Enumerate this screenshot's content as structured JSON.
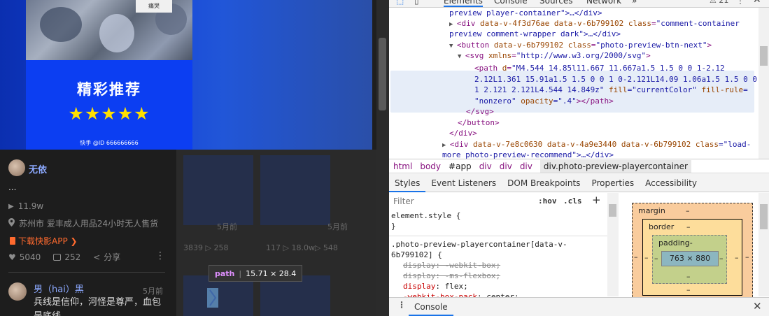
{
  "page": {
    "thumb_sticker": "痛哭",
    "hero_title": "精彩推荐",
    "stars": "★★★★★",
    "watermark": "快手 @ID 666666666",
    "author": "无依",
    "description": "...",
    "plays": "11.9w",
    "location": "苏州市 爱丰成人用品24小时无人售货",
    "download_link": "下载快影APP ❯",
    "likes": "5040",
    "comments": "252",
    "share": "分享",
    "background_labels": [
      "5月前",
      "5月前",
      "3839 ▷ 258",
      "117 ▷ 18.0w▷ 548"
    ],
    "comment": {
      "author": "男（hai）黑",
      "time": "5月前",
      "text": "兵线是信仰，河怪是尊严，血包是底线"
    },
    "tooltip": {
      "tag": "path",
      "size": "15.71 × 28.4"
    }
  },
  "devtools": {
    "tabs": [
      "Elements",
      "Console",
      "Sources",
      "Network"
    ],
    "more_tabs": "»",
    "warnings": "21",
    "dom": {
      "line0": {
        "text": "preview player-container\">…</div>"
      },
      "line1": {
        "tag": "<div ",
        "a1": "data-v-4f3d76ae",
        "a2": " data-v-6b799102 ",
        "a3n": "class",
        "a3v": "\"comment-container"
      },
      "line1b": {
        "text": "preview comment-wrapper dark\">…</div>"
      },
      "line2": {
        "tag": "<button ",
        "a1": "data-v-6b799102 ",
        "a2n": "class",
        "a2v": "\"photo-preview-btn-next\"",
        "close": ">"
      },
      "line3": {
        "tag": "<svg ",
        "a1n": "xmlns",
        "a1v": "\"http://www.w3.org/2000/svg\"",
        "close": ">"
      },
      "line4": {
        "tag": "<path ",
        "a1n": "d",
        "a1v": "\"M4.544 14.85l11.667 11.667a1.5 1.5 0 0 1-2.12"
      },
      "line4b": {
        "text": "2.12L1.361 15.91a1.5 1.5 0 0 1 0-2.121L14.09 1.06a1.5 1.5 0 0"
      },
      "line4c": {
        "text": "1 2.121 2.121L4.544 14.849z\"",
        "a2n": " fill",
        "a2v": "=\"currentColor\"",
        "a3n": " fill-rule",
        "a3v": "="
      },
      "line4d": {
        "text": "\"nonzero\"",
        "a4n": " opacity",
        "a4v": "=\".4\"",
        "close": "></path>"
      },
      "line5": {
        "text": "</svg>"
      },
      "line6": {
        "text": "</button>"
      },
      "line7": {
        "text": "</div>"
      },
      "line8": {
        "tag": "<div ",
        "a1": "data-v-7e8c0630 data-v-4a9e3440 data-v-6b799102 ",
        "a2n": "class",
        "a2v": "=\"load-"
      },
      "line8b": {
        "text": "more photo-preview-recommend\">…</div>"
      }
    },
    "breadcrumbs": [
      "html",
      "body",
      "#app",
      "div",
      "div",
      "div",
      "div.photo-preview-playercontainer"
    ],
    "subtabs": [
      "Styles",
      "Event Listeners",
      "DOM Breakpoints",
      "Properties",
      "Accessibility"
    ],
    "styles": {
      "filter_placeholder": "Filter",
      "hov": ":hov",
      "cls": ".cls",
      "plus": "+",
      "element_style": "element.style {",
      "close_brace": "}",
      "selector1": ".photo-preview-playercontainer[data-v-",
      "selector2": "6b799102] {",
      "decl1": "display: -webkit-box;",
      "decl2": "display: -ms-flexbox;",
      "decl3p": "display",
      "decl3v": ": flex;",
      "decl4p": "-webkit-box-pack",
      "decl4v": ": center;"
    },
    "box_model": {
      "margin_label": "margin",
      "border_label": "border",
      "padding_label": "padding-",
      "content": "763 × 880",
      "dash": "–"
    },
    "drawer": {
      "menu": "⋮",
      "tab": "Console",
      "close": "✕"
    }
  }
}
